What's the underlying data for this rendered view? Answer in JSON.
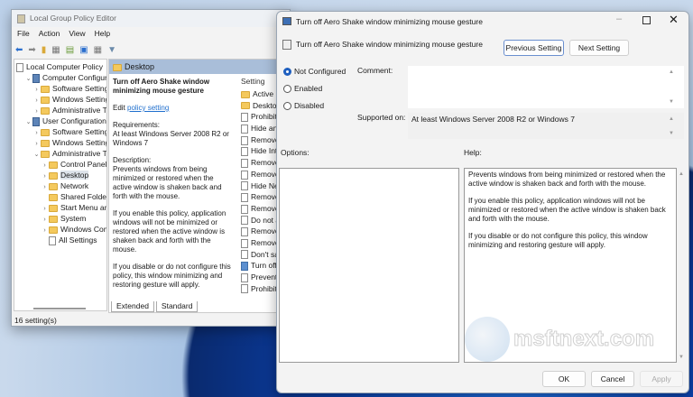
{
  "main_window": {
    "title": "Local Group Policy Editor",
    "menu": [
      "File",
      "Action",
      "View",
      "Help"
    ],
    "tree": [
      {
        "label": "Local Computer Policy",
        "level": 0,
        "chevron": "",
        "icon": "policy"
      },
      {
        "label": "Computer Configuration",
        "level": 1,
        "chevron": "v",
        "icon": "computer"
      },
      {
        "label": "Software Settings",
        "level": 2,
        "chevron": ">",
        "icon": "folder"
      },
      {
        "label": "Windows Settings",
        "level": 2,
        "chevron": ">",
        "icon": "folder"
      },
      {
        "label": "Administrative Templates",
        "level": 2,
        "chevron": ">",
        "icon": "folder"
      },
      {
        "label": "User Configuration",
        "level": 1,
        "chevron": "v",
        "icon": "user"
      },
      {
        "label": "Software Settings",
        "level": 2,
        "chevron": ">",
        "icon": "folder"
      },
      {
        "label": "Windows Settings",
        "level": 2,
        "chevron": ">",
        "icon": "folder"
      },
      {
        "label": "Administrative Templates",
        "level": 2,
        "chevron": "v",
        "icon": "folder"
      },
      {
        "label": "Control Panel",
        "level": 3,
        "chevron": ">",
        "icon": "folder"
      },
      {
        "label": "Desktop",
        "level": 3,
        "chevron": ">",
        "icon": "folder",
        "selected": true
      },
      {
        "label": "Network",
        "level": 3,
        "chevron": ">",
        "icon": "folder"
      },
      {
        "label": "Shared Folders",
        "level": 3,
        "chevron": "",
        "icon": "folder"
      },
      {
        "label": "Start Menu and Taskbar",
        "level": 3,
        "chevron": ">",
        "icon": "folder"
      },
      {
        "label": "System",
        "level": 3,
        "chevron": ">",
        "icon": "folder"
      },
      {
        "label": "Windows Components",
        "level": 3,
        "chevron": ">",
        "icon": "folder"
      },
      {
        "label": "All Settings",
        "level": 3,
        "chevron": "",
        "icon": "allsettings"
      }
    ],
    "header": "Desktop",
    "detail": {
      "title": "Turn off Aero Shake window minimizing mouse gesture",
      "edit_prefix": "Edit ",
      "edit_link": "policy setting",
      "requirements_label": "Requirements:",
      "requirements": "At least Windows Server 2008 R2 or Windows 7",
      "description_label": "Description:",
      "paragraphs": [
        "Prevents windows from being minimized or restored when the active window is shaken back and forth with the mouse.",
        "If you enable this policy, application windows will not be minimized or restored when the active window is shaken back and forth with the mouse.",
        "If you disable or do not configure this policy, this window minimizing and restoring gesture will apply."
      ]
    },
    "settings_header": "Setting",
    "settings": [
      {
        "label": "Active Desktop",
        "type": "folder"
      },
      {
        "label": "Desktop",
        "type": "folder"
      },
      {
        "label": "Prohibit",
        "type": "doc"
      },
      {
        "label": "Hide and",
        "type": "doc"
      },
      {
        "label": "Remove",
        "type": "doc"
      },
      {
        "label": "Hide Inte",
        "type": "doc"
      },
      {
        "label": "Remove",
        "type": "doc"
      },
      {
        "label": "Remove",
        "type": "doc"
      },
      {
        "label": "Hide Net",
        "type": "doc"
      },
      {
        "label": "Remove",
        "type": "doc"
      },
      {
        "label": "Remove",
        "type": "doc"
      },
      {
        "label": "Do not a",
        "type": "doc"
      },
      {
        "label": "Remove",
        "type": "doc"
      },
      {
        "label": "Remove",
        "type": "doc"
      },
      {
        "label": "Don't sa",
        "type": "doc"
      },
      {
        "label": "Turn off",
        "type": "sel"
      },
      {
        "label": "Prevent a",
        "type": "doc"
      },
      {
        "label": "Prohibit",
        "type": "doc"
      }
    ],
    "tabs": [
      "Extended",
      "Standard"
    ],
    "status": "16 setting(s)"
  },
  "dialog": {
    "title": "Turn off Aero Shake window minimizing mouse gesture",
    "subtitle": "Turn off Aero Shake window minimizing mouse gesture",
    "previous": "Previous Setting",
    "next": "Next Setting",
    "radios": [
      "Not Configured",
      "Enabled",
      "Disabled"
    ],
    "comment_label": "Comment:",
    "comment_value": "",
    "supported_label": "Supported on:",
    "supported_value": "At least Windows Server 2008 R2 or Windows 7",
    "options_label": "Options:",
    "help_label": "Help:",
    "help": [
      "Prevents windows from being minimized or restored when the active window is shaken back and forth with the mouse.",
      "If you enable this policy, application windows will not be minimized or restored when the active window is shaken back and forth with the mouse.",
      "If you disable or do not configure this policy, this window minimizing and restoring gesture will apply."
    ],
    "ok": "OK",
    "cancel": "Cancel",
    "apply": "Apply"
  },
  "watermark": "msftnext.com"
}
